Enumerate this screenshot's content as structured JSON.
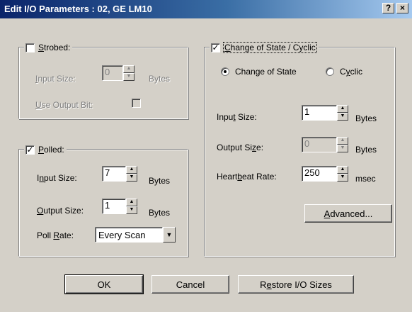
{
  "window": {
    "title": "Edit I/O Parameters : 02, GE LM10",
    "help_label": "?",
    "close_label": "×"
  },
  "strobed": {
    "label_pre": "",
    "label_key": "S",
    "label_post": "trobed:",
    "checked": false,
    "input_size_label_pre": "",
    "input_size_label_key": "I",
    "input_size_label_post": "nput Size:",
    "input_size_value": "0",
    "bytes_label": "Bytes",
    "use_output_bit_pre": "",
    "use_output_bit_key": "U",
    "use_output_bit_post": "se Output Bit:"
  },
  "polled": {
    "label_pre": "",
    "label_key": "P",
    "label_post": "olled:",
    "checked": true,
    "checkmark": "✓",
    "input_size_label_pre": "I",
    "input_size_label_key": "n",
    "input_size_label_post": "put Size:",
    "input_size_value": "7",
    "input_bytes": "Bytes",
    "output_size_label_pre": "",
    "output_size_label_key": "O",
    "output_size_label_post": "utput Size:",
    "output_size_value": "1",
    "output_bytes": "Bytes",
    "poll_rate_label_pre": "Poll ",
    "poll_rate_label_key": "R",
    "poll_rate_label_post": "ate:",
    "poll_rate_value": "Every Scan"
  },
  "cos": {
    "label_pre": "",
    "label_key": "C",
    "label_post": "hange of State / Cyclic",
    "checked": true,
    "checkmark": "✓",
    "radio_change_label": "Change of State",
    "radio_cyclic_pre": "C",
    "radio_cyclic_key": "y",
    "radio_cyclic_post": "clic",
    "selected": "change_of_state",
    "input_size_label_pre": "Inpu",
    "input_size_label_key": "t",
    "input_size_label_post": " Size:",
    "input_size_value": "1",
    "input_bytes": "Bytes",
    "output_size_label_pre": "Output Si",
    "output_size_label_key": "z",
    "output_size_label_post": "e:",
    "output_size_value": "0",
    "output_bytes": "Bytes",
    "heartbeat_label_pre": "Heart",
    "heartbeat_label_key": "b",
    "heartbeat_label_post": "eat Rate:",
    "heartbeat_value": "250",
    "heartbeat_unit": "msec",
    "advanced_pre": "",
    "advanced_key": "A",
    "advanced_post": "dvanced..."
  },
  "buttons": {
    "ok_label": "OK",
    "cancel_label": "Cancel",
    "restore_pre": "R",
    "restore_key": "e",
    "restore_post": "store I/O Sizes"
  },
  "glyphs": {
    "up": "▲",
    "down": "▼"
  }
}
